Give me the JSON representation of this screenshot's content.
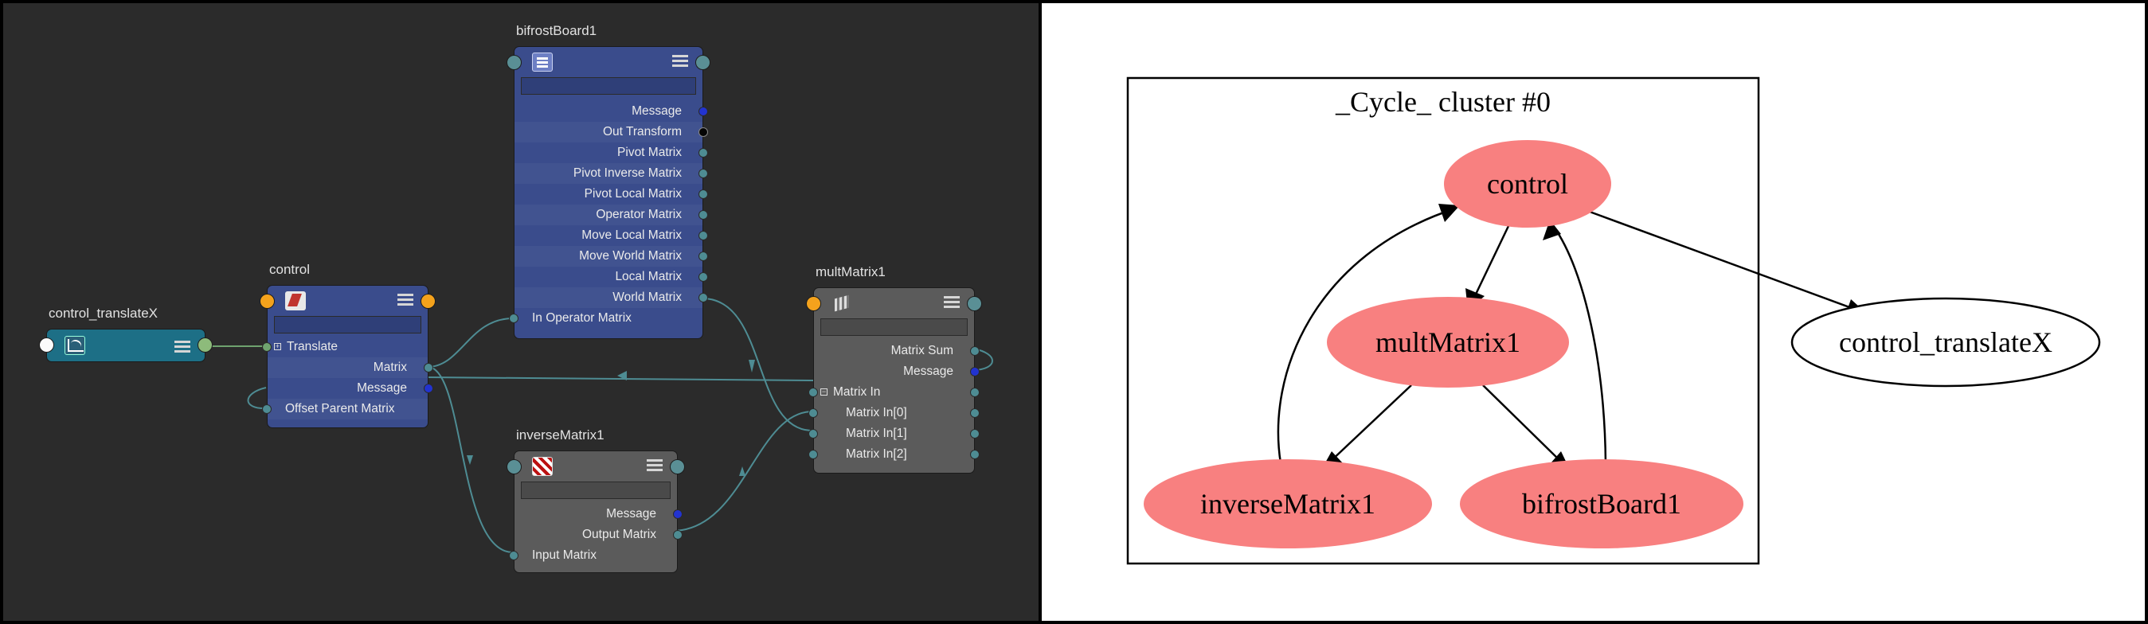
{
  "node_editor": {
    "nodes": {
      "bifrost": {
        "title": "bifrostBoard1",
        "ports": [
          "Message",
          "Out Transform",
          "Pivot Matrix",
          "Pivot Inverse Matrix",
          "Pivot Local Matrix",
          "Operator Matrix",
          "Move Local Matrix",
          "Move World Matrix",
          "Local Matrix",
          "World Matrix",
          "In Operator Matrix"
        ]
      },
      "control": {
        "title": "control",
        "ports": [
          "Translate",
          "Matrix",
          "Message",
          "Offset Parent Matrix"
        ]
      },
      "translate": {
        "title": "control_translateX"
      },
      "inverse": {
        "title": "inverseMatrix1",
        "ports": [
          "Message",
          "Output Matrix",
          "Input Matrix"
        ]
      },
      "mult": {
        "title": "multMatrix1",
        "ports": [
          "Matrix Sum",
          "Message",
          "Matrix In",
          "Matrix In[0]",
          "Matrix In[1]",
          "Matrix In[2]"
        ]
      }
    },
    "colors": {
      "background": "#2b2b2b",
      "dg_node": "#3a4c8c",
      "utility_node": "#5b5b5b",
      "anim_curve_node": "#1d6f86",
      "connection": "#4e8c93"
    },
    "icons": [
      "lines-icon",
      "transform-icon",
      "checker-icon",
      "cubes-icon",
      "anim-curve-icon",
      "menu-icon"
    ]
  },
  "graph": {
    "cluster_label": "_Cycle_ cluster #0",
    "nodes": {
      "control": "control",
      "multMatrix1": "multMatrix1",
      "inverseMatrix1": "inverseMatrix1",
      "bifrostBoard1": "bifrostBoard1",
      "control_translateX": "control_translateX"
    },
    "edges": [
      [
        "control",
        "multMatrix1"
      ],
      [
        "multMatrix1",
        "inverseMatrix1"
      ],
      [
        "multMatrix1",
        "bifrostBoard1"
      ],
      [
        "inverseMatrix1",
        "control"
      ],
      [
        "bifrostBoard1",
        "control"
      ],
      [
        "control",
        "control_translateX"
      ]
    ],
    "colors": {
      "cycle_fill": "#f88080",
      "plain_fill": "#ffffff",
      "stroke": "#000000"
    }
  }
}
